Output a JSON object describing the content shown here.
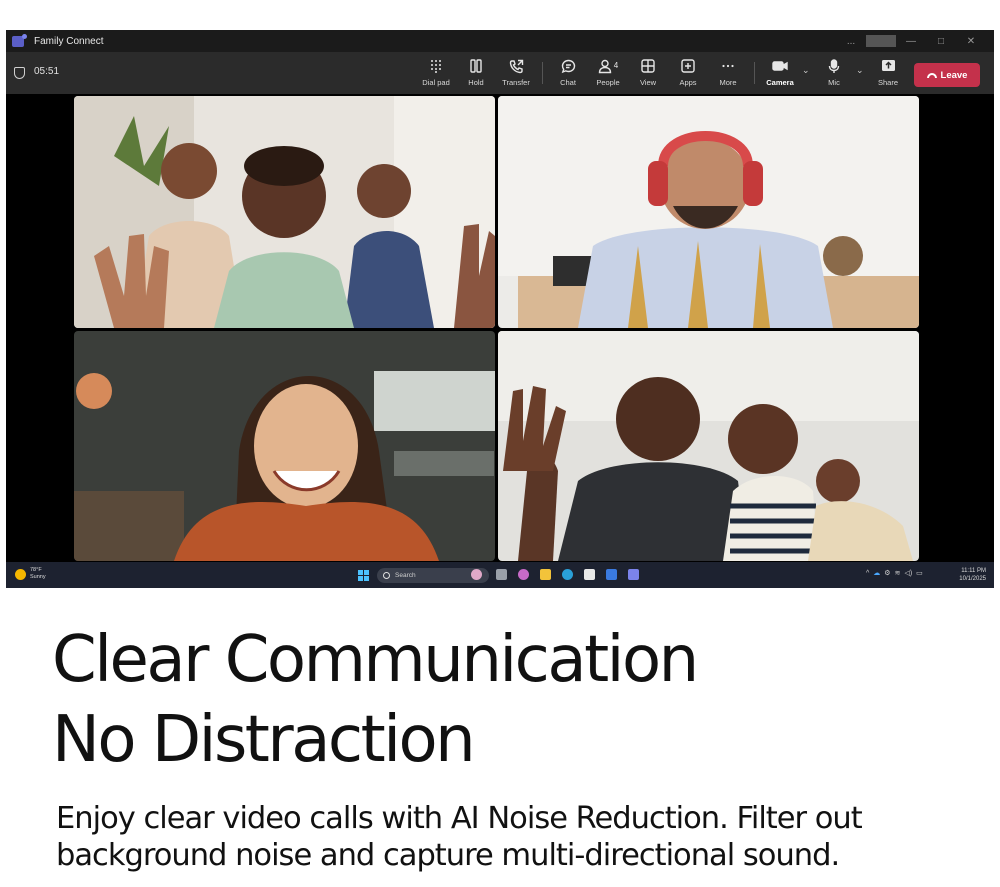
{
  "window": {
    "app_title": "Family Connect",
    "controls": [
      "...",
      "—",
      "□",
      "✕"
    ]
  },
  "call": {
    "timer": "05:51",
    "toolbar": [
      {
        "id": "dialpad",
        "label": "Dial pad",
        "icon": "dialpad-icon"
      },
      {
        "id": "hold",
        "label": "Hold",
        "icon": "pause-icon"
      },
      {
        "id": "transfer",
        "label": "Transfer",
        "icon": "phone-transfer-icon"
      },
      {
        "id": "chat",
        "label": "Chat",
        "icon": "chat-bubble-icon"
      },
      {
        "id": "people",
        "label": "People",
        "icon": "people-icon",
        "count": "4"
      },
      {
        "id": "view",
        "label": "View",
        "icon": "grid-icon"
      },
      {
        "id": "apps",
        "label": "Apps",
        "icon": "plus-square-icon"
      },
      {
        "id": "more",
        "label": "More",
        "icon": "ellipsis-icon"
      },
      {
        "id": "camera",
        "label": "Camera",
        "icon": "camera-icon"
      },
      {
        "id": "mic",
        "label": "Mic",
        "icon": "microphone-icon"
      },
      {
        "id": "share",
        "label": "Share",
        "icon": "share-icon"
      }
    ],
    "leave_label": "Leave",
    "leave_color": "#c4314b"
  },
  "taskbar": {
    "temperature": "78°F",
    "condition": "Sunny",
    "search_placeholder": "Search",
    "time": "11:11 PM",
    "date": "10/1/2025"
  },
  "marketing": {
    "headline_line1": "Clear Communication",
    "headline_line2": "No Distraction",
    "body": "Enjoy clear video calls with AI Noise Reduction. Filter out background noise and capture multi-directional sound."
  }
}
